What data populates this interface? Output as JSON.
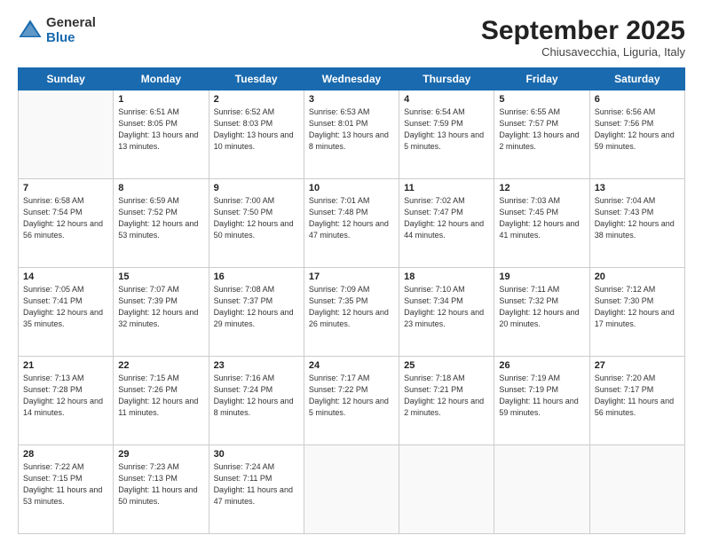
{
  "logo": {
    "general": "General",
    "blue": "Blue"
  },
  "header": {
    "month": "September 2025",
    "location": "Chiusavecchia, Liguria, Italy"
  },
  "days_of_week": [
    "Sunday",
    "Monday",
    "Tuesday",
    "Wednesday",
    "Thursday",
    "Friday",
    "Saturday"
  ],
  "weeks": [
    [
      {
        "day": null
      },
      {
        "day": "1",
        "sunrise": "6:51 AM",
        "sunset": "8:05 PM",
        "daylight": "13 hours and 13 minutes."
      },
      {
        "day": "2",
        "sunrise": "6:52 AM",
        "sunset": "8:03 PM",
        "daylight": "13 hours and 10 minutes."
      },
      {
        "day": "3",
        "sunrise": "6:53 AM",
        "sunset": "8:01 PM",
        "daylight": "13 hours and 8 minutes."
      },
      {
        "day": "4",
        "sunrise": "6:54 AM",
        "sunset": "7:59 PM",
        "daylight": "13 hours and 5 minutes."
      },
      {
        "day": "5",
        "sunrise": "6:55 AM",
        "sunset": "7:57 PM",
        "daylight": "13 hours and 2 minutes."
      },
      {
        "day": "6",
        "sunrise": "6:56 AM",
        "sunset": "7:56 PM",
        "daylight": "12 hours and 59 minutes."
      }
    ],
    [
      {
        "day": "7",
        "sunrise": "6:58 AM",
        "sunset": "7:54 PM",
        "daylight": "12 hours and 56 minutes."
      },
      {
        "day": "8",
        "sunrise": "6:59 AM",
        "sunset": "7:52 PM",
        "daylight": "12 hours and 53 minutes."
      },
      {
        "day": "9",
        "sunrise": "7:00 AM",
        "sunset": "7:50 PM",
        "daylight": "12 hours and 50 minutes."
      },
      {
        "day": "10",
        "sunrise": "7:01 AM",
        "sunset": "7:48 PM",
        "daylight": "12 hours and 47 minutes."
      },
      {
        "day": "11",
        "sunrise": "7:02 AM",
        "sunset": "7:47 PM",
        "daylight": "12 hours and 44 minutes."
      },
      {
        "day": "12",
        "sunrise": "7:03 AM",
        "sunset": "7:45 PM",
        "daylight": "12 hours and 41 minutes."
      },
      {
        "day": "13",
        "sunrise": "7:04 AM",
        "sunset": "7:43 PM",
        "daylight": "12 hours and 38 minutes."
      }
    ],
    [
      {
        "day": "14",
        "sunrise": "7:05 AM",
        "sunset": "7:41 PM",
        "daylight": "12 hours and 35 minutes."
      },
      {
        "day": "15",
        "sunrise": "7:07 AM",
        "sunset": "7:39 PM",
        "daylight": "12 hours and 32 minutes."
      },
      {
        "day": "16",
        "sunrise": "7:08 AM",
        "sunset": "7:37 PM",
        "daylight": "12 hours and 29 minutes."
      },
      {
        "day": "17",
        "sunrise": "7:09 AM",
        "sunset": "7:35 PM",
        "daylight": "12 hours and 26 minutes."
      },
      {
        "day": "18",
        "sunrise": "7:10 AM",
        "sunset": "7:34 PM",
        "daylight": "12 hours and 23 minutes."
      },
      {
        "day": "19",
        "sunrise": "7:11 AM",
        "sunset": "7:32 PM",
        "daylight": "12 hours and 20 minutes."
      },
      {
        "day": "20",
        "sunrise": "7:12 AM",
        "sunset": "7:30 PM",
        "daylight": "12 hours and 17 minutes."
      }
    ],
    [
      {
        "day": "21",
        "sunrise": "7:13 AM",
        "sunset": "7:28 PM",
        "daylight": "12 hours and 14 minutes."
      },
      {
        "day": "22",
        "sunrise": "7:15 AM",
        "sunset": "7:26 PM",
        "daylight": "12 hours and 11 minutes."
      },
      {
        "day": "23",
        "sunrise": "7:16 AM",
        "sunset": "7:24 PM",
        "daylight": "12 hours and 8 minutes."
      },
      {
        "day": "24",
        "sunrise": "7:17 AM",
        "sunset": "7:22 PM",
        "daylight": "12 hours and 5 minutes."
      },
      {
        "day": "25",
        "sunrise": "7:18 AM",
        "sunset": "7:21 PM",
        "daylight": "12 hours and 2 minutes."
      },
      {
        "day": "26",
        "sunrise": "7:19 AM",
        "sunset": "7:19 PM",
        "daylight": "11 hours and 59 minutes."
      },
      {
        "day": "27",
        "sunrise": "7:20 AM",
        "sunset": "7:17 PM",
        "daylight": "11 hours and 56 minutes."
      }
    ],
    [
      {
        "day": "28",
        "sunrise": "7:22 AM",
        "sunset": "7:15 PM",
        "daylight": "11 hours and 53 minutes."
      },
      {
        "day": "29",
        "sunrise": "7:23 AM",
        "sunset": "7:13 PM",
        "daylight": "11 hours and 50 minutes."
      },
      {
        "day": "30",
        "sunrise": "7:24 AM",
        "sunset": "7:11 PM",
        "daylight": "11 hours and 47 minutes."
      },
      {
        "day": null
      },
      {
        "day": null
      },
      {
        "day": null
      },
      {
        "day": null
      }
    ]
  ]
}
